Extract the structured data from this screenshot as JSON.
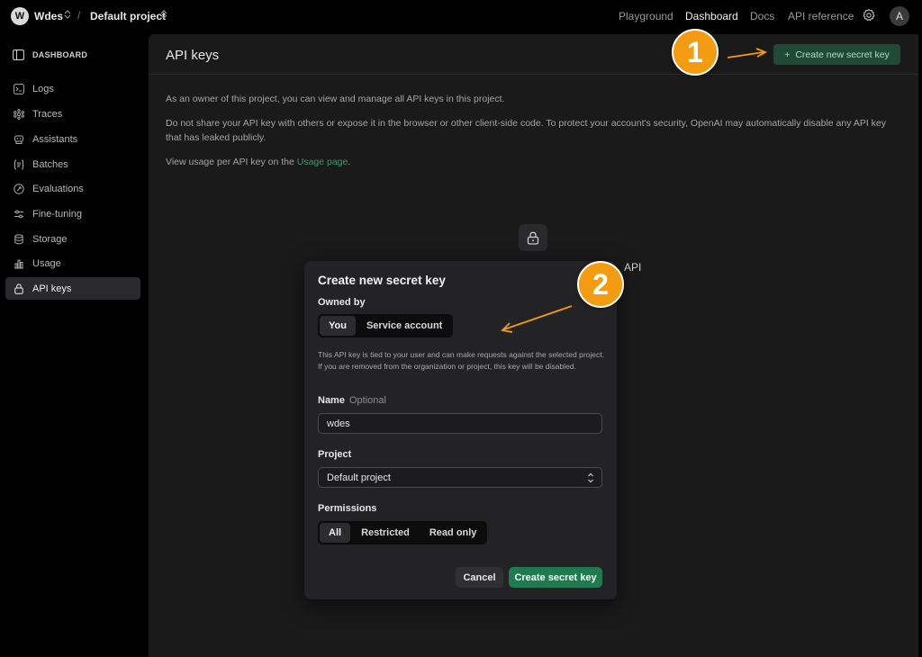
{
  "topbar": {
    "workspace_initial": "W",
    "workspace_name": "Wdes",
    "separator": "/",
    "project_name": "Default project",
    "nav": [
      "Playground",
      "Dashboard",
      "Docs",
      "API reference"
    ],
    "active_nav": "Dashboard",
    "user_initial": "A"
  },
  "sidebar": {
    "header": "DASHBOARD",
    "items": [
      {
        "label": "Logs",
        "icon": "terminal-icon"
      },
      {
        "label": "Traces",
        "icon": "traces-icon"
      },
      {
        "label": "Assistants",
        "icon": "assistant-icon"
      },
      {
        "label": "Batches",
        "icon": "batches-icon"
      },
      {
        "label": "Evaluations",
        "icon": "evaluations-icon"
      },
      {
        "label": "Fine-tuning",
        "icon": "sliders-icon"
      },
      {
        "label": "Storage",
        "icon": "database-icon"
      },
      {
        "label": "Usage",
        "icon": "bar-chart-icon"
      },
      {
        "label": "API keys",
        "icon": "lock-icon"
      }
    ],
    "active_item": "API keys"
  },
  "main": {
    "title": "API keys",
    "create_button": "Create new secret key",
    "para1": "As an owner of this project, you can view and manage all API keys in this project.",
    "para2": "Do not share your API key with others or expose it in the browser or other client-side code. To protect your account's security, OpenAI may automatically disable any API key that has leaked publicly.",
    "para3_prefix": "View usage per API key on the ",
    "para3_link": "Usage page",
    "para3_suffix": ".",
    "background_partial": "API"
  },
  "modal": {
    "title": "Create new secret key",
    "owned_by_label": "Owned by",
    "owned_by_options": [
      "You",
      "Service account"
    ],
    "owned_by_selected": "You",
    "help_text": "This API key is tied to your user and can make requests against the selected project. If you are removed from the organization or project, this key will be disabled.",
    "name_label": "Name",
    "name_optional": "Optional",
    "name_value": "wdes",
    "project_label": "Project",
    "project_value": "Default project",
    "permissions_label": "Permissions",
    "permissions_options": [
      "All",
      "Restricted",
      "Read only"
    ],
    "permissions_selected": "All",
    "cancel_label": "Cancel",
    "create_label": "Create secret key"
  },
  "annotations": {
    "badge1": "1",
    "badge2": "2",
    "color": "#f39c12"
  },
  "colors": {
    "accent_green": "#1f7a4f",
    "link_green": "#3e9a6b"
  }
}
